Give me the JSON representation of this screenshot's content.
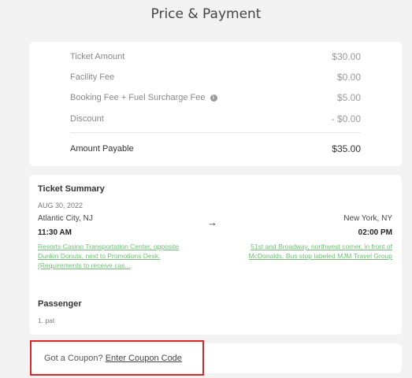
{
  "header": {
    "title": "Price & Payment"
  },
  "price": {
    "rows": [
      {
        "label": "Ticket Amount",
        "value": "$30.00"
      },
      {
        "label": "Facility Fee",
        "value": "$0.00"
      },
      {
        "label": "Booking Fee + Fuel Surcharge Fee",
        "value": "$5.00"
      },
      {
        "label": "Discount",
        "value": "- $0.00"
      }
    ],
    "total": {
      "label": "Amount Payable",
      "value": "$35.00"
    }
  },
  "summary": {
    "title": "Ticket Summary",
    "date": "AUG 30, 2022",
    "from_city": "Atlantic City, NJ",
    "to_city": "New York, NY",
    "depart_time": "11:30 AM",
    "arrive_time": "02:00 PM",
    "arrow": "→",
    "from_location": "Resorts Casino Transportation Center, opposite Dunkin Donuts, next to Promotions Desk. (Requirements to receive cas...",
    "to_location": "51st and Broadway, northwest corner, in front of McDonalds. Bus stop labeled MJM Travel Group",
    "passenger_title": "Passenger",
    "passenger": "1. pat"
  },
  "coupon": {
    "prompt": "Got a Coupon?",
    "link": "Enter Coupon Code"
  },
  "colors": {
    "link_green": "#6fbf73",
    "highlight_red": "#d9262b"
  },
  "icons": {
    "info": "info-icon"
  }
}
